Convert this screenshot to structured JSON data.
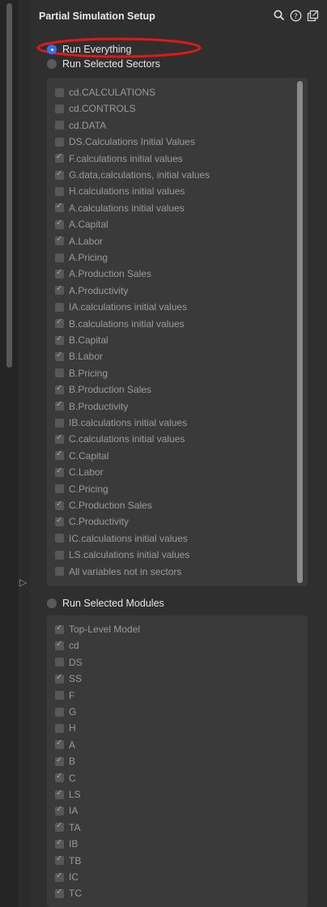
{
  "header": {
    "title": "Partial Simulation Setup",
    "icons": [
      "search-icon",
      "help-icon",
      "popout-icon"
    ]
  },
  "options": {
    "run_everything": "Run Everything",
    "run_selected_sectors": "Run Selected Sectors",
    "run_selected_modules": "Run Selected Modules",
    "selected": "Run Everything"
  },
  "sectors": [
    {
      "label": "cd.CALCULATIONS",
      "checked": false
    },
    {
      "label": "cd.CONTROLS",
      "checked": false
    },
    {
      "label": "cd.DATA",
      "checked": false
    },
    {
      "label": "DS.Calculations  Initial Values",
      "checked": false
    },
    {
      "label": "F.calculations  initial values",
      "checked": true
    },
    {
      "label": "G.data,calculations, initial values",
      "checked": true
    },
    {
      "label": "H.calculations  initial values",
      "checked": false
    },
    {
      "label": "A.calculations  initial values",
      "checked": true
    },
    {
      "label": "A.Capital",
      "checked": true
    },
    {
      "label": "A.Labor",
      "checked": true
    },
    {
      "label": "A.Pricing",
      "checked": false
    },
    {
      "label": "A.Production  Sales",
      "checked": true
    },
    {
      "label": "A.Productivity",
      "checked": true
    },
    {
      "label": "IA.calculations  initial values",
      "checked": false
    },
    {
      "label": "B.calculations  initial values",
      "checked": true
    },
    {
      "label": "B.Capital",
      "checked": true
    },
    {
      "label": "B.Labor",
      "checked": true
    },
    {
      "label": "B.Pricing",
      "checked": false
    },
    {
      "label": "B.Production  Sales",
      "checked": true
    },
    {
      "label": "B.Productivity",
      "checked": true
    },
    {
      "label": "IB.calculations  initial values",
      "checked": false
    },
    {
      "label": "C.calculations  initial values",
      "checked": true
    },
    {
      "label": "C.Capital",
      "checked": true
    },
    {
      "label": "C.Labor",
      "checked": true
    },
    {
      "label": "C.Pricing",
      "checked": false
    },
    {
      "label": "C.Production  Sales",
      "checked": true
    },
    {
      "label": "C.Productivity",
      "checked": true
    },
    {
      "label": "IC.calculations  initial values",
      "checked": false
    },
    {
      "label": "LS.calculations  initial values",
      "checked": false
    },
    {
      "label": "All variables not in sectors",
      "checked": false
    }
  ],
  "modules": [
    {
      "label": "Top-Level Model",
      "checked": true
    },
    {
      "label": "cd",
      "checked": true
    },
    {
      "label": "DS",
      "checked": false
    },
    {
      "label": "SS",
      "checked": true
    },
    {
      "label": "F",
      "checked": false
    },
    {
      "label": "G",
      "checked": false
    },
    {
      "label": "H",
      "checked": false
    },
    {
      "label": "A",
      "checked": true
    },
    {
      "label": "B",
      "checked": true
    },
    {
      "label": "C",
      "checked": true
    },
    {
      "label": "LS",
      "checked": true
    },
    {
      "label": "IA",
      "checked": true
    },
    {
      "label": "TA",
      "checked": true
    },
    {
      "label": "IB",
      "checked": true
    },
    {
      "label": "TB",
      "checked": true
    },
    {
      "label": "IC",
      "checked": true
    },
    {
      "label": "TC",
      "checked": true
    }
  ],
  "colors": {
    "accent": "#2a72ff",
    "annotation": "#e01818",
    "panel": "#2f2f2f",
    "listbox": "#3a3a3a"
  }
}
